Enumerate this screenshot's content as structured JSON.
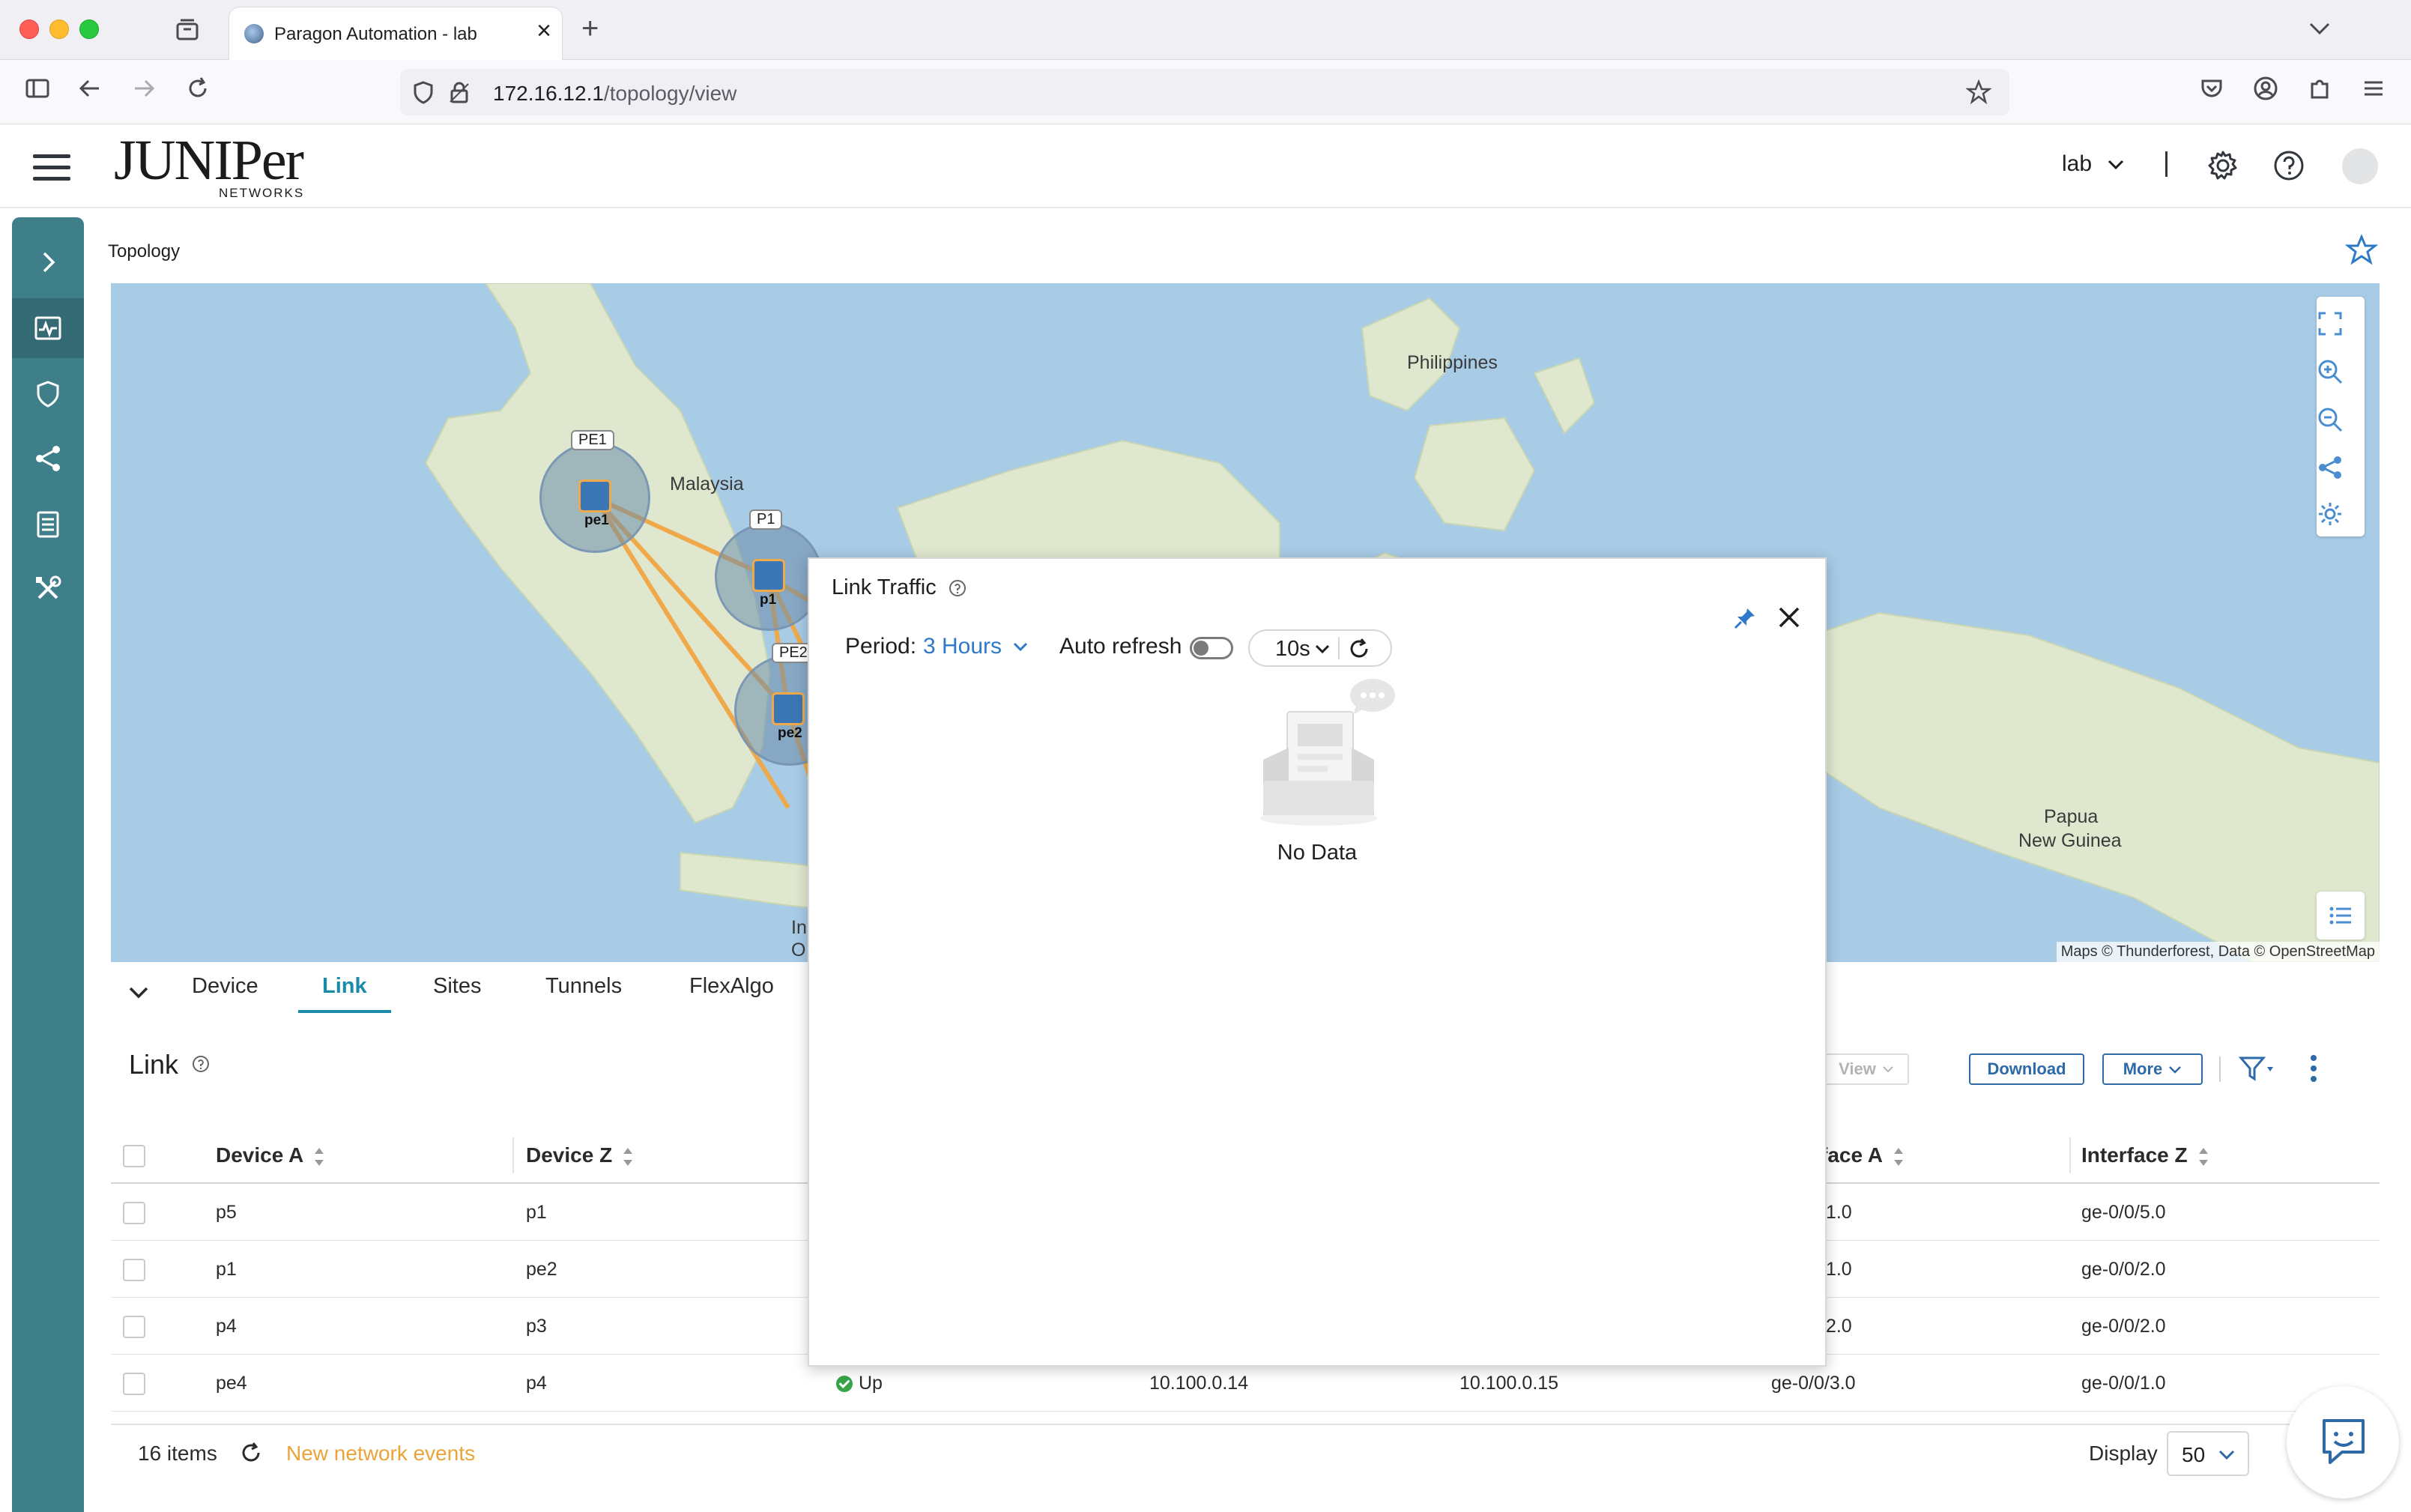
{
  "browser": {
    "tab_title": "Paragon Automation - lab",
    "url_host": "172.16.12.1",
    "url_path": "/topology/view"
  },
  "header": {
    "logo_main": "JUNIPer",
    "logo_sub": "NETWORKS",
    "user_label": "lab"
  },
  "page": {
    "breadcrumb": "Topology"
  },
  "map": {
    "labels": [
      "Philippines",
      "Malaysia",
      "Papua New Guinea",
      "In",
      "O"
    ],
    "papua_line1": "Papua",
    "papua_line2": "New Guinea",
    "attribution": "Maps © Thunderforest, Data © OpenStreetMap",
    "nodes": [
      {
        "tag": "PE1",
        "name": "pe1"
      },
      {
        "tag": "P1",
        "name": "p1"
      },
      {
        "tag": "PE2",
        "name": "pe2"
      }
    ]
  },
  "panel": {
    "tabs": [
      "Device",
      "Link",
      "Sites",
      "Tunnels",
      "FlexAlgo"
    ],
    "active_tab": "Link",
    "title": "Link",
    "buttons": {
      "view": "View",
      "download": "Download",
      "more": "More"
    },
    "columns": {
      "device_a": "Device A",
      "device_z": "Device Z",
      "interface_a": "Interface A",
      "interface_a_visible": "face A",
      "interface_z": "Interface Z"
    },
    "rows": [
      {
        "device_a": "p5",
        "device_z": "p1",
        "interface_a": "/1.0",
        "interface_z": "ge-0/0/5.0"
      },
      {
        "device_a": "p1",
        "device_z": "pe2",
        "interface_a": "/1.0",
        "interface_z": "ge-0/0/2.0"
      },
      {
        "device_a": "p4",
        "device_z": "p3",
        "interface_a": "/2.0",
        "interface_z": "ge-0/0/2.0"
      },
      {
        "device_a": "pe4",
        "device_z": "p4",
        "status": "Up",
        "ip_a": "10.100.0.14",
        "ip_z": "10.100.0.15",
        "interface_a": "ge-0/0/3.0",
        "interface_z": "ge-0/0/1.0"
      }
    ],
    "footer": {
      "items": "16 items",
      "events": "New network events",
      "display_label": "Display",
      "display_value": "50"
    }
  },
  "popup": {
    "title": "Link Traffic",
    "period_label": "Period:",
    "period_value": "3 Hours",
    "auto_refresh_label": "Auto refresh",
    "auto_refresh_on": false,
    "interval": "10s",
    "empty_text": "No Data"
  },
  "colors": {
    "rail": "#3f7f8a",
    "accent": "#1a8aa8",
    "link_blue": "#2e6aa8",
    "map_water": "#a8cbe6",
    "map_land": "#dfe8cf",
    "topology_link": "#f0a94a",
    "status_up": "#37a449",
    "events": "#e9a43a"
  }
}
